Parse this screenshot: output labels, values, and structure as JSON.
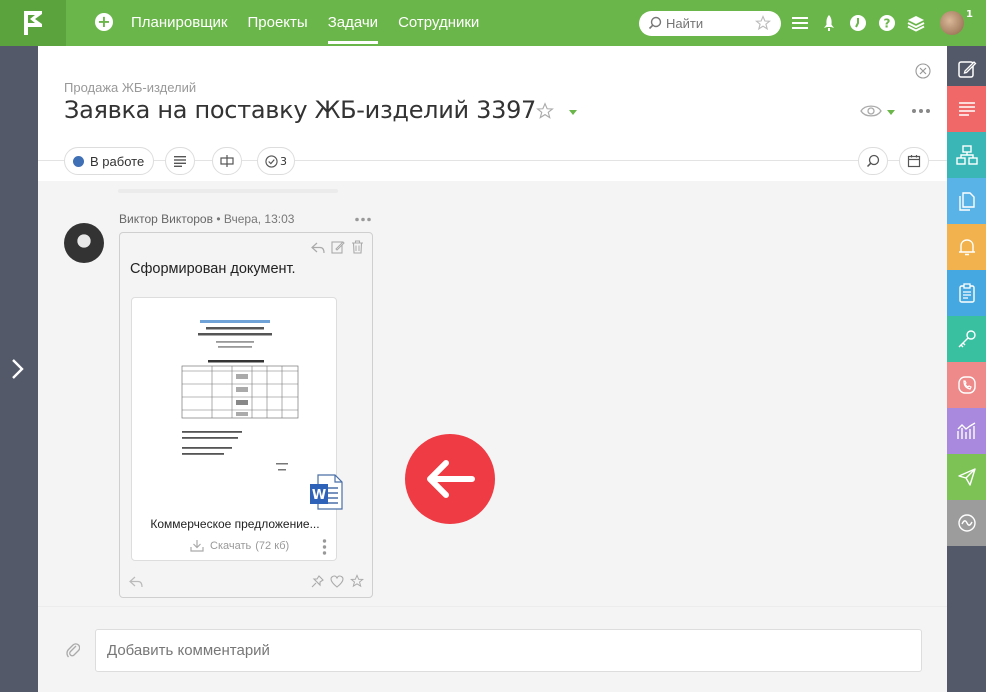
{
  "topbar": {
    "nav": [
      {
        "label": "Планировщик",
        "active": false
      },
      {
        "label": "Проекты",
        "active": false
      },
      {
        "label": "Задачи",
        "active": true
      },
      {
        "label": "Сотрудники",
        "active": false
      }
    ],
    "search_placeholder": "Найти",
    "notification_count": "1",
    "accent": "#6bb64a"
  },
  "task": {
    "breadcrumb": "Продажа ЖБ-изделий",
    "title": "Заявка на поставку ЖБ-изделий 3397",
    "status_label": "В работе",
    "status_color": "#3f6fb4",
    "checklist_count": "3"
  },
  "comment": {
    "author": "Виктор Викторов",
    "time": "• Вчера, 13:03",
    "text": "Сформирован документ.",
    "attachment": {
      "name": "Коммерческое предложение...",
      "download_label": "Скачать",
      "size": "(72 кб)"
    }
  },
  "composer": {
    "placeholder": "Добавить комментарий"
  },
  "right_rail": [
    {
      "icon": "edit-icon",
      "color": "#54596a"
    },
    {
      "icon": "list-icon",
      "color": "#f06868"
    },
    {
      "icon": "org-icon",
      "color": "#3bb6b6"
    },
    {
      "icon": "files-icon",
      "color": "#59b3e6"
    },
    {
      "icon": "bell-icon",
      "color": "#f2b24e"
    },
    {
      "icon": "clipboard-icon",
      "color": "#45a8e0"
    },
    {
      "icon": "key-icon",
      "color": "#39c0a0"
    },
    {
      "icon": "contact-icon",
      "color": "#ef8a8a"
    },
    {
      "icon": "chart-icon",
      "color": "#a889dd"
    },
    {
      "icon": "send-icon",
      "color": "#7cc255"
    },
    {
      "icon": "wave-icon",
      "color": "#9c9c9c"
    }
  ]
}
